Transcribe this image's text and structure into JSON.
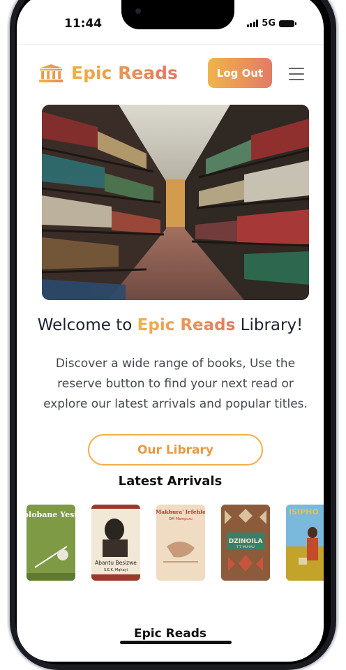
{
  "status_bar": {
    "time": "11:44",
    "network": "5G"
  },
  "header": {
    "brand_name": "Epic Reads",
    "logout_label": "Log Out",
    "menu_icon": "hamburger-menu-icon",
    "logo_icon": "bank-icon"
  },
  "hero": {
    "icon": "library-shelves-image"
  },
  "welcome": {
    "prefix": "Welcome to ",
    "brand": "Epic Reads",
    "suffix": " Library!"
  },
  "description": "Discover a wide range of books, Use the reserve button to find your next read or explore our latest arrivals and popular titles.",
  "library_button_label": "Our Library",
  "latest_arrivals": {
    "heading": "Latest Arrivals",
    "books": [
      {
        "title": "Ingolobane Yesizwe"
      },
      {
        "title": "Abantu Besizwe",
        "author": "S.E.K. Mqhayi"
      },
      {
        "title": "Makhura' lefehlo",
        "author": "DM Mampuru"
      },
      {
        "title": "DZINOILA",
        "author": "T.T. MUHAU"
      },
      {
        "title": "ISIPHO"
      }
    ]
  },
  "footer": {
    "brand": "Epic Reads"
  },
  "colors": {
    "accent_start": "#f0b34a",
    "accent_end": "#e27861",
    "text_dark": "#1c2230"
  }
}
